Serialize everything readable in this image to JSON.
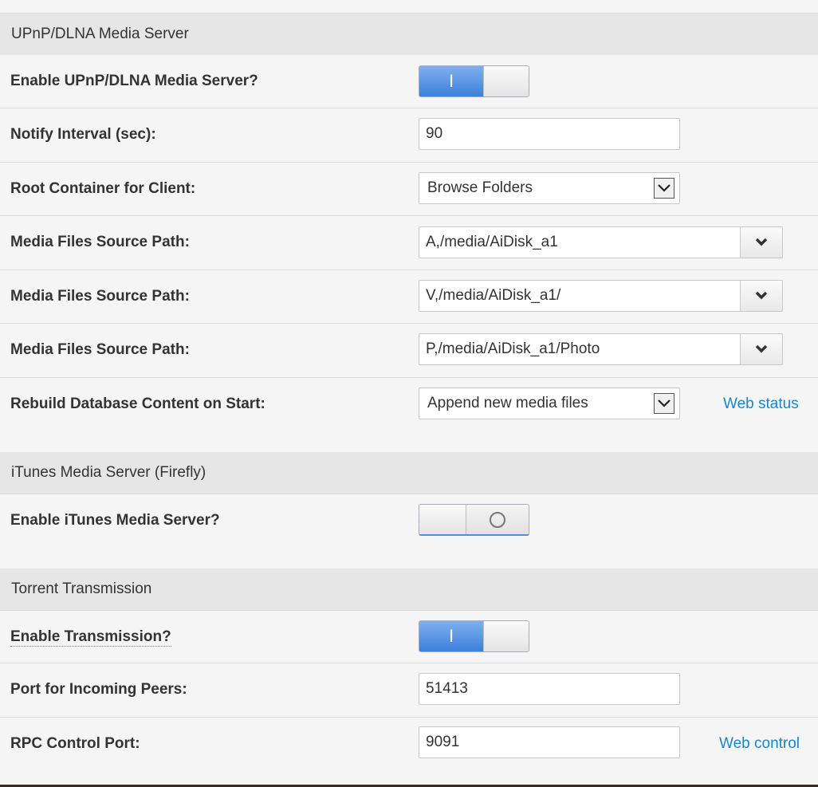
{
  "sections": {
    "upnp": {
      "title": "UPnP/DLNA Media Server"
    },
    "itunes": {
      "title": "iTunes Media Server (Firefly)"
    },
    "torrent": {
      "title": "Torrent Transmission"
    }
  },
  "upnp": {
    "enable": {
      "label": "Enable UPnP/DLNA Media Server?",
      "on_glyph": "I",
      "state": "on"
    },
    "notify_interval": {
      "label": "Notify Interval (sec):",
      "value": "90"
    },
    "root_container": {
      "label": "Root Container for Client:",
      "selected": "Browse Folders"
    },
    "source_paths": [
      {
        "label": "Media Files Source Path:",
        "value": "A,/media/AiDisk_a1"
      },
      {
        "label": "Media Files Source Path:",
        "value": "V,/media/AiDisk_a1/"
      },
      {
        "label": "Media Files Source Path:",
        "value": "P,/media/AiDisk_a1/Photo"
      }
    ],
    "rebuild": {
      "label": "Rebuild Database Content on Start:",
      "selected": "Append new media files"
    },
    "web_status_link": "Web status"
  },
  "itunes": {
    "enable": {
      "label": "Enable iTunes Media Server?",
      "state": "off"
    }
  },
  "torrent": {
    "enable": {
      "label": "Enable Transmission?",
      "on_glyph": "I",
      "state": "on"
    },
    "peer_port": {
      "label": "Port for Incoming Peers:",
      "value": "51413"
    },
    "rpc_port": {
      "label": "RPC Control Port:",
      "value": "9091"
    },
    "web_control_link": "Web control"
  },
  "colors": {
    "accent_blue": "#3d7fdc",
    "link": "#1a86c8",
    "section_bg": "#e6e6e6"
  }
}
